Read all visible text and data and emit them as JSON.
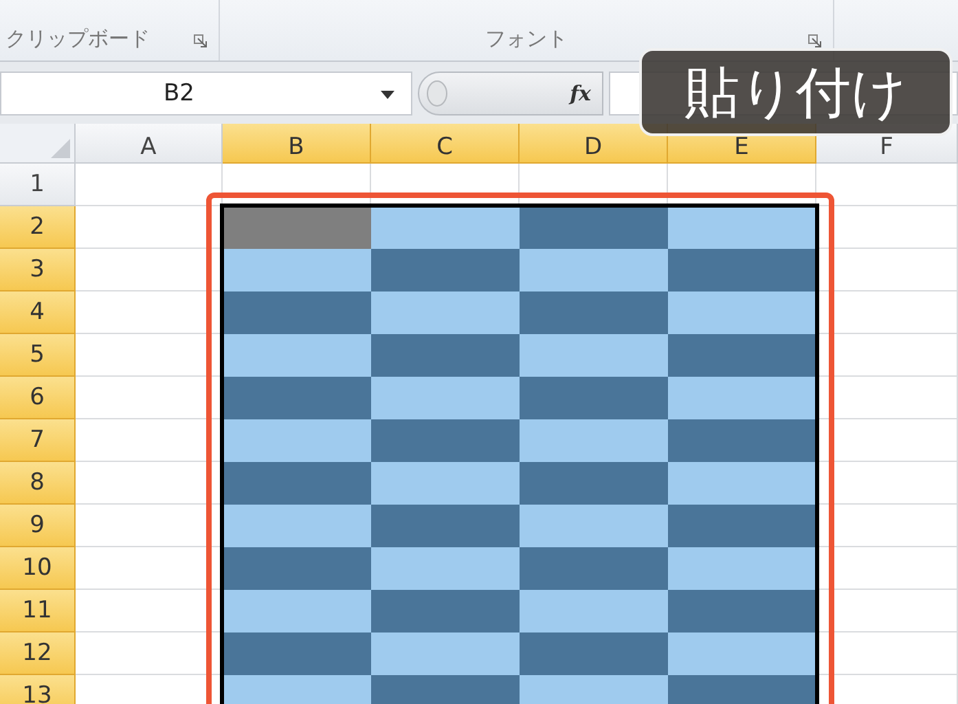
{
  "ribbon": {
    "groups": [
      {
        "label": "クリップボード"
      },
      {
        "label": "フォント"
      }
    ]
  },
  "formula_bar": {
    "name_box": "B2",
    "fx": "fx"
  },
  "sheet": {
    "columns": [
      {
        "label": "A",
        "selected": false
      },
      {
        "label": "B",
        "selected": true
      },
      {
        "label": "C",
        "selected": true
      },
      {
        "label": "D",
        "selected": true
      },
      {
        "label": "E",
        "selected": true
      },
      {
        "label": "F",
        "selected": false
      }
    ],
    "rows": [
      {
        "header": "1",
        "selected": false,
        "cells": []
      },
      {
        "header": "2",
        "selected": true,
        "cells": [
          {
            "color": "#7f7f7f"
          },
          {
            "color": "#9fcbee"
          },
          {
            "color": "#4a7599"
          },
          {
            "color": "#9fcbee"
          }
        ]
      },
      {
        "header": "3",
        "selected": true,
        "cells": [
          {
            "color": "#9fcbee"
          },
          {
            "color": "#4a7599"
          },
          {
            "color": "#9fcbee"
          },
          {
            "color": "#4a7599"
          }
        ]
      },
      {
        "header": "4",
        "selected": true,
        "cells": [
          {
            "color": "#4a7599"
          },
          {
            "color": "#9fcbee"
          },
          {
            "color": "#4a7599"
          },
          {
            "color": "#9fcbee"
          }
        ]
      },
      {
        "header": "5",
        "selected": true,
        "cells": [
          {
            "color": "#9fcbee"
          },
          {
            "color": "#4a7599"
          },
          {
            "color": "#9fcbee"
          },
          {
            "color": "#4a7599"
          }
        ]
      },
      {
        "header": "6",
        "selected": true,
        "cells": [
          {
            "color": "#4a7599"
          },
          {
            "color": "#9fcbee"
          },
          {
            "color": "#4a7599"
          },
          {
            "color": "#9fcbee"
          }
        ]
      },
      {
        "header": "7",
        "selected": true,
        "cells": [
          {
            "color": "#9fcbee"
          },
          {
            "color": "#4a7599"
          },
          {
            "color": "#9fcbee"
          },
          {
            "color": "#4a7599"
          }
        ]
      },
      {
        "header": "8",
        "selected": true,
        "cells": [
          {
            "color": "#4a7599"
          },
          {
            "color": "#9fcbee"
          },
          {
            "color": "#4a7599"
          },
          {
            "color": "#9fcbee"
          }
        ]
      },
      {
        "header": "9",
        "selected": true,
        "cells": [
          {
            "color": "#9fcbee"
          },
          {
            "color": "#4a7599"
          },
          {
            "color": "#9fcbee"
          },
          {
            "color": "#4a7599"
          }
        ]
      },
      {
        "header": "10",
        "selected": true,
        "cells": [
          {
            "color": "#4a7599"
          },
          {
            "color": "#9fcbee"
          },
          {
            "color": "#4a7599"
          },
          {
            "color": "#9fcbee"
          }
        ]
      },
      {
        "header": "11",
        "selected": true,
        "cells": [
          {
            "color": "#9fcbee"
          },
          {
            "color": "#4a7599"
          },
          {
            "color": "#9fcbee"
          },
          {
            "color": "#4a7599"
          }
        ]
      },
      {
        "header": "12",
        "selected": true,
        "cells": [
          {
            "color": "#4a7599"
          },
          {
            "color": "#9fcbee"
          },
          {
            "color": "#4a7599"
          },
          {
            "color": "#9fcbee"
          }
        ]
      },
      {
        "header": "13",
        "selected": true,
        "cells": [
          {
            "color": "#9fcbee"
          },
          {
            "color": "#4a7599"
          },
          {
            "color": "#9fcbee"
          },
          {
            "color": "#4a7599"
          }
        ]
      }
    ]
  },
  "caption": {
    "text": "貼り付け"
  }
}
